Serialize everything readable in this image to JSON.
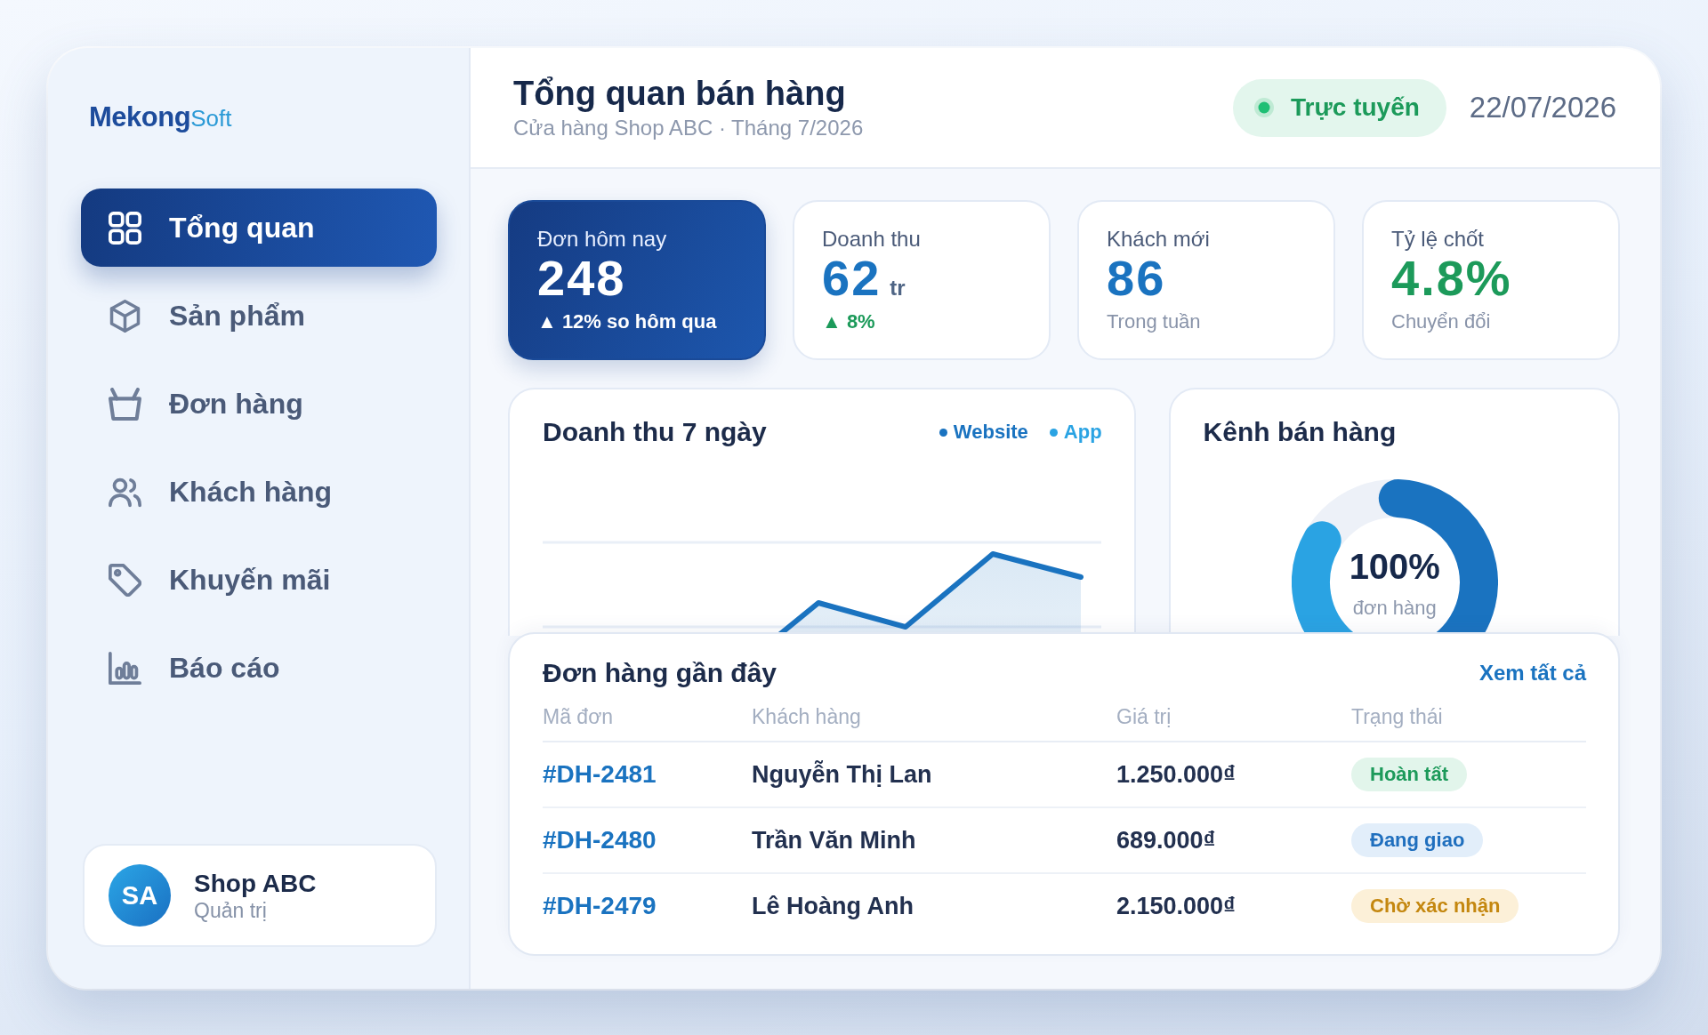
{
  "sidebar": {
    "logo": {
      "primary": "Mekong",
      "secondary": "Soft"
    },
    "items": [
      {
        "label": "Tổng quan",
        "selected": true
      },
      {
        "label": "Sản phẩm",
        "selected": false
      },
      {
        "label": "Đơn hàng",
        "selected": false
      },
      {
        "label": "Khách hàng",
        "selected": false
      },
      {
        "label": "Khuyến mãi",
        "selected": false
      },
      {
        "label": "Báo cáo",
        "selected": false
      }
    ],
    "profile": {
      "initials": "SA",
      "name": "Shop ABC",
      "role": "Quản trị"
    }
  },
  "header": {
    "title": "Tổng quan bán hàng",
    "subtitle": "Cửa hàng Shop ABC · Tháng 7/2026",
    "status": {
      "label": "Trực tuyến",
      "online": true
    },
    "date": "22/07/2026"
  },
  "stats": [
    {
      "kind": "highlight",
      "label": "Đơn hôm nay",
      "value": "248",
      "note": "▲ 12% so hôm qua"
    },
    {
      "kind": "change",
      "label": "Doanh thu",
      "value": "62",
      "unit": "tr",
      "note": "▲ 8%",
      "color": "#1a73c0"
    },
    {
      "kind": "caption",
      "label": "Khách mới",
      "value": "86",
      "note": "Trong tuần",
      "color": "#1a73c0"
    },
    {
      "kind": "caption",
      "label": "Tỷ lệ chốt",
      "value": "4.8%",
      "note": "Chuyển đổi",
      "color": "#1c9a5a"
    }
  ],
  "revenue_chart": {
    "title": "Doanh thu 7 ngày",
    "legend": [
      {
        "label": "Website",
        "color": "#1a73c0"
      },
      {
        "label": "App",
        "color": "#2aa3e3"
      }
    ]
  },
  "channel_chart": {
    "title": "Kênh bán hàng",
    "center_value": "100%",
    "center_label": "đơn hàng"
  },
  "recent_orders": {
    "title": "Đơn hàng gần đây",
    "link": "Xem tất cả",
    "columns": [
      "Mã đơn",
      "Khách hàng",
      "Giá trị",
      "Trạng thái"
    ],
    "rows": [
      {
        "order_id": "#DH-2481",
        "customer": "Nguyễn Thị Lan",
        "amount": "1.250.000₫",
        "status": {
          "label": "Hoàn tất",
          "kind": "done"
        }
      },
      {
        "order_id": "#DH-2480",
        "customer": "Trần Văn Minh",
        "amount": "689.000₫",
        "status": {
          "label": "Đang giao",
          "kind": "shipping"
        }
      },
      {
        "order_id": "#DH-2479",
        "customer": "Lê Hoàng Anh",
        "amount": "2.150.000₫",
        "status": {
          "label": "Chờ xác nhận",
          "kind": "pending"
        }
      }
    ]
  }
}
